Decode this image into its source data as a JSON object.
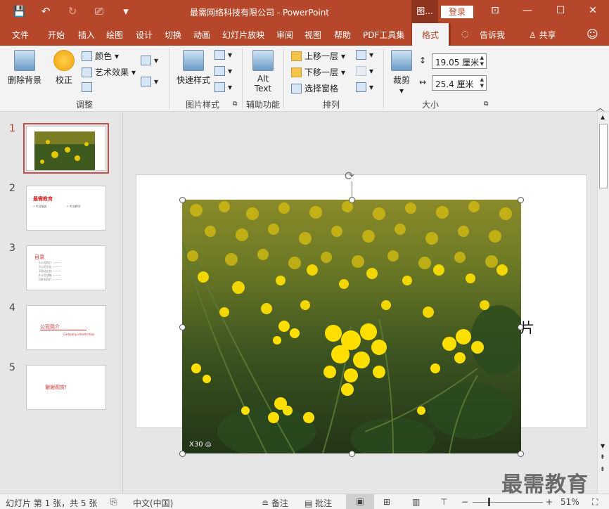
{
  "window": {
    "title": "最需网络科技有限公司  -  PowerPoint",
    "context_tab": "图...",
    "login": "登录",
    "qat": {
      "save": "💾",
      "undo": "↶",
      "redo": "↻",
      "present": "⎚",
      "more": "▾"
    },
    "controls": {
      "ribbon_display": "⊡",
      "minimize": "—",
      "maximize": "☐",
      "close": "✕"
    }
  },
  "tabs": [
    "文件",
    "开始",
    "插入",
    "绘图",
    "设计",
    "切换",
    "动画",
    "幻灯片放映",
    "审阅",
    "视图",
    "帮助",
    "PDF工具集",
    "格式",
    "告诉我",
    "共享"
  ],
  "active_tab": "格式",
  "ribbon": {
    "groups": {
      "adjust": "调整",
      "picture_styles": "图片样式",
      "accessibility": "辅助功能",
      "arrange": "排列",
      "size": "大小"
    },
    "buttons": {
      "remove_bg": "删除背景",
      "correct": "校正",
      "color": "颜色",
      "artistic": "艺术效果",
      "quick_styles": "快速样式",
      "alt_text_1": "Alt",
      "alt_text_2": "Text",
      "bring_forward": "上移一层",
      "send_backward": "下移一层",
      "selection_pane": "选择窗格",
      "crop": "裁剪"
    },
    "size": {
      "height": "19.05 厘米",
      "width": "25.4 厘米"
    }
  },
  "thumbnails": [
    {
      "num": "1",
      "active": true
    },
    {
      "num": "2",
      "text_a": "最需教育",
      "text_b": "• 专业服务",
      "text_c": "• 专业教学"
    },
    {
      "num": "3",
      "text_a": "目录",
      "lines": [
        "1公司简介 ———",
        "2公司文化 ———",
        "3网站支持 ———",
        "4公司战略 ———",
        "5联系我们 ———"
      ]
    },
    {
      "num": "4",
      "text_a": "公司简介",
      "text_b": "Company introduction"
    },
    {
      "num": "5",
      "text_a": "谢谢观赏！"
    }
  ],
  "picture": {
    "watermark": "X30 ◎"
  },
  "cursor": "片",
  "status": {
    "slide_info": "幻灯片 第 1 张，共 5 张",
    "language": "中文(中国)",
    "notes": "备注",
    "comments": "批注",
    "zoom": "51%"
  },
  "watermark": "最需教育",
  "colors": {
    "brand": "#b7472a",
    "context": "#8e3520",
    "flower": "#f2d600"
  }
}
